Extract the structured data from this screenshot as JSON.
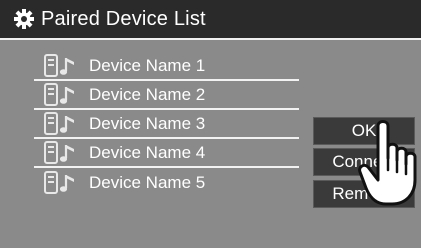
{
  "header": {
    "title": "Paired Device List",
    "icon": "gear-icon"
  },
  "devices": [
    {
      "name": "Device Name 1",
      "icon": "phone-audio-icon"
    },
    {
      "name": "Device Name 2",
      "icon": "phone-audio-icon"
    },
    {
      "name": "Device Name 3",
      "icon": "phone-audio-icon"
    },
    {
      "name": "Device Name 4",
      "icon": "phone-audio-icon"
    },
    {
      "name": "Device Name 5",
      "icon": "phone-audio-icon"
    }
  ],
  "actions": {
    "ok_label": "OK",
    "connect_label": "Connect",
    "remove_label": "Remove"
  },
  "overlay": {
    "icon": "pointing-hand-icon"
  },
  "colors": {
    "background": "#8a8a8a",
    "titlebar": "#2a2a2a",
    "button": "#3a3a3a",
    "text": "#ffffff"
  }
}
